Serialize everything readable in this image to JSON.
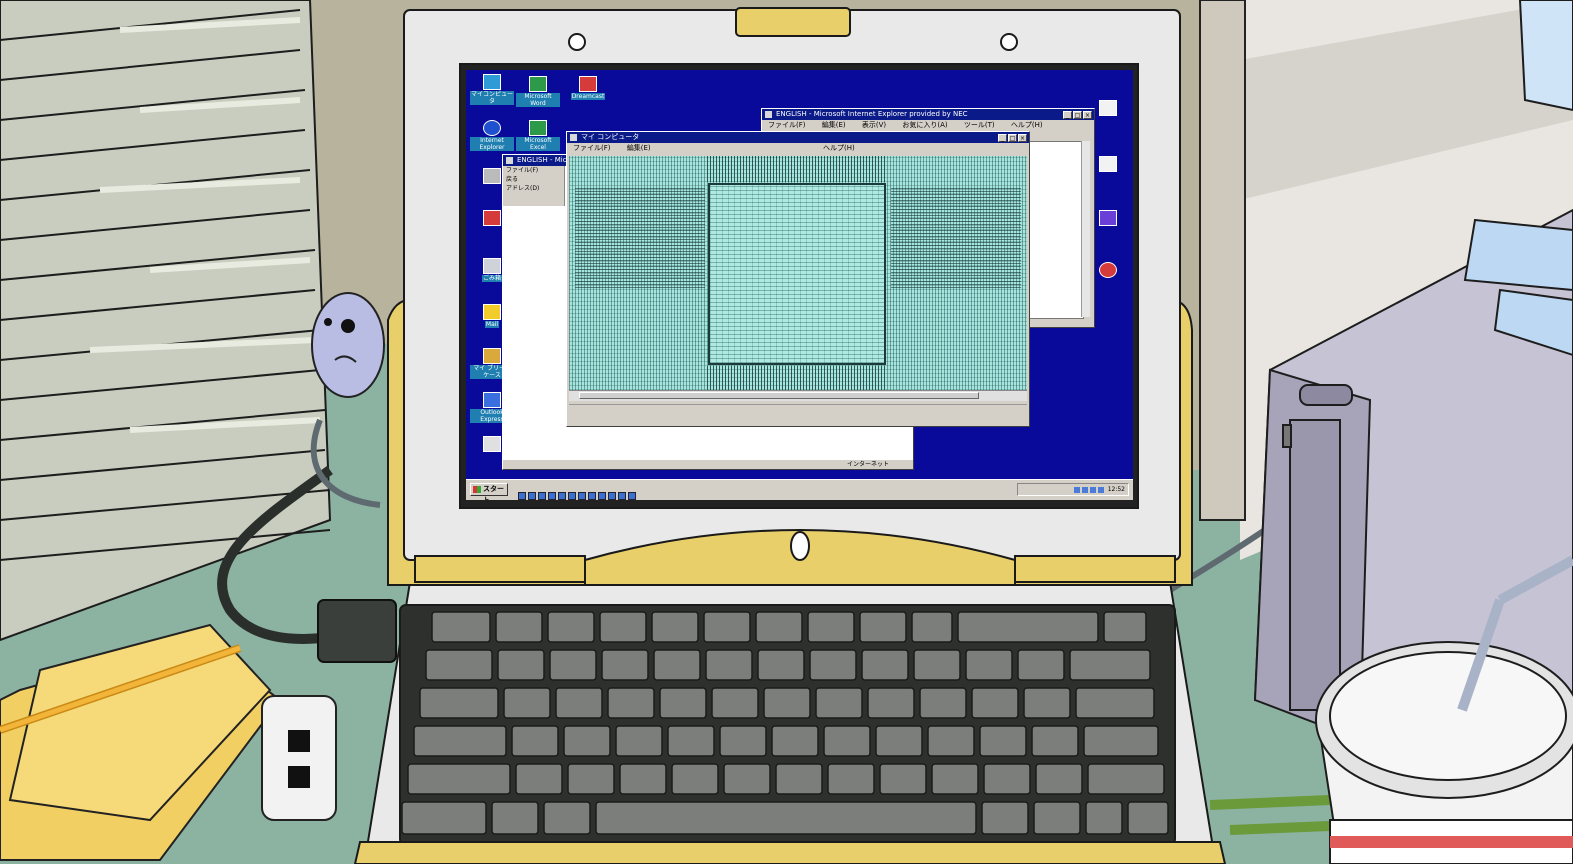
{
  "colors": {
    "desktop": "#0a0a9a",
    "titlebar": "#0a1a88",
    "window_face": "#d4d0c8",
    "viewer_content": "#a7e6de",
    "laptop_shell": "#e8e8e8",
    "laptop_accent": "#e9cf6a",
    "keys": "#7a7d7a"
  },
  "desktop_icons": [
    {
      "icon": "my-computer-icon",
      "label": "マイコンピュータ"
    },
    {
      "icon": "network-icon",
      "label": "Microsoft Word"
    },
    {
      "icon": "app-red-icon",
      "label": "Dreamcast"
    },
    {
      "icon": "internet-explorer-icon",
      "label": "Internet Explorer"
    },
    {
      "icon": "excel-icon",
      "label": "Microsoft Excel"
    },
    {
      "icon": "shortcut-icon",
      "label": ""
    },
    {
      "icon": "recycle-bin-icon",
      "label": "ごみ箱"
    },
    {
      "icon": "folder-icon",
      "label": "Mail"
    },
    {
      "icon": "briefcase-icon",
      "label": "マイ ブリーフケース"
    },
    {
      "icon": "outlook-icon",
      "label": "Outlook Express"
    },
    {
      "icon": "setup-icon",
      "label": ""
    }
  ],
  "windows": {
    "ie": {
      "title": "ENGLISH - Microsoft Internet Explorer provided by NEC",
      "menus": [
        "ファイル(F)",
        "編集(E)",
        "表示(V)",
        "お気に入り(A)",
        "ツール(T)",
        "ヘルプ(H)"
      ]
    },
    "left": {
      "title": "ENGLISH - Mic",
      "panel_lines": [
        "ファイル(F)",
        "戻る",
        "アドレス(D)"
      ],
      "status": "インターネット"
    },
    "my_computer": {
      "title": "マイ コンピュータ",
      "menus": [
        "ファイル(F)",
        "編集(E)"
      ],
      "help": "ヘルプ(H)"
    }
  },
  "taskbar": {
    "start_label": "スタート",
    "clock": "12:52"
  }
}
